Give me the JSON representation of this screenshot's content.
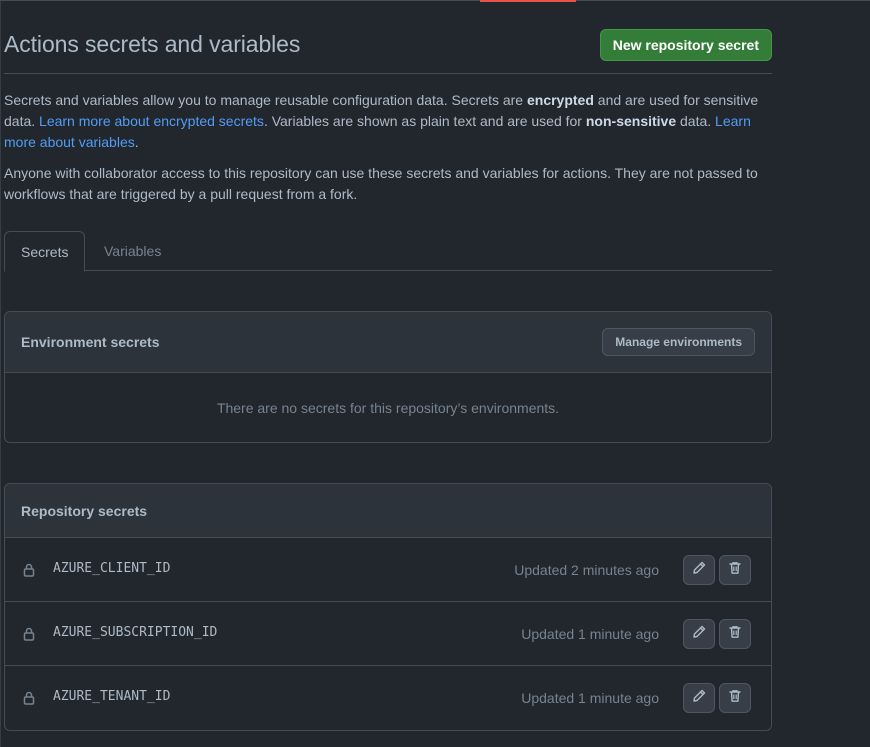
{
  "header": {
    "title": "Actions secrets and variables",
    "new_secret_label": "New repository secret"
  },
  "description": {
    "p1_a": "Secrets and variables allow you to manage reusable configuration data. Secrets are ",
    "p1_b": "encrypted",
    "p1_c": " and are used for sensitive data. ",
    "p1_link1": "Learn more about encrypted secrets",
    "p1_d": ". Variables are shown as plain text and are used for ",
    "p1_e": "non-sensitive",
    "p1_f": " data. ",
    "p1_link2": "Learn more about variables",
    "p1_g": ".",
    "p2": "Anyone with collaborator access to this repository can use these secrets and variables for actions. They are not passed to workflows that are triggered by a pull request from a fork."
  },
  "tabs": [
    {
      "label": "Secrets",
      "active": true
    },
    {
      "label": "Variables",
      "active": false
    }
  ],
  "environment_secrets": {
    "title": "Environment secrets",
    "manage_label": "Manage environments",
    "empty_text": "There are no secrets for this repository’s environments."
  },
  "repository_secrets": {
    "title": "Repository secrets",
    "items": [
      {
        "name": "AZURE_CLIENT_ID",
        "updated": "Updated 2 minutes ago"
      },
      {
        "name": "AZURE_SUBSCRIPTION_ID",
        "updated": "Updated 1 minute ago"
      },
      {
        "name": "AZURE_TENANT_ID",
        "updated": "Updated 1 minute ago"
      }
    ]
  },
  "icons": {
    "row_icon": "lock-icon",
    "edit": "pencil-icon",
    "delete": "trash-icon"
  },
  "colors": {
    "background": "#22272e",
    "primary_button": "#347d39",
    "link": "#539bf5",
    "accent": "#e5534b"
  }
}
